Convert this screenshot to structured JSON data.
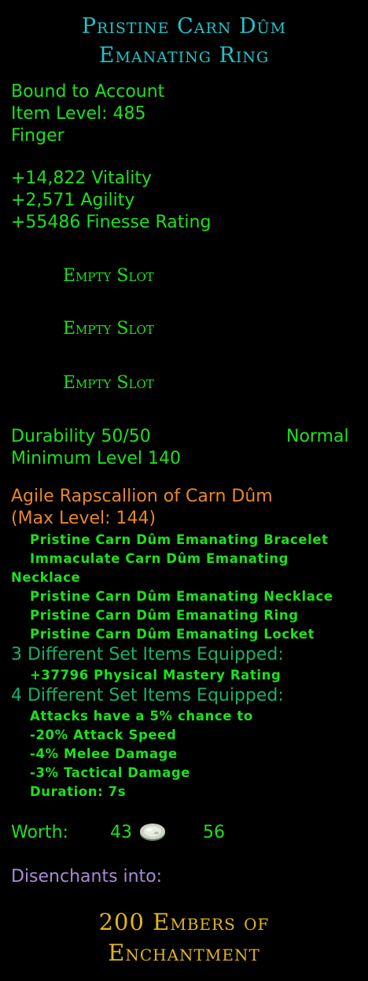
{
  "item": {
    "name_line1": "Pristine Carn Dûm",
    "name_line2": "Emanating Ring",
    "binding": "Bound to Account",
    "item_level": "Item Level: 485",
    "slot": "Finger",
    "stats": [
      "+14,822 Vitality",
      "+2,571 Agility",
      "+55486 Finesse Rating"
    ],
    "empty_slots": [
      "Empty Slot",
      "Empty Slot",
      "Empty Slot"
    ],
    "durability": "Durability 50/50",
    "durability_state": "Normal",
    "minimum_level": "Minimum Level 140"
  },
  "set": {
    "name": "Agile Rapscallion of Carn Dûm",
    "max_level": "(Max Level: 144)",
    "items": [
      "Pristine Carn Dûm Emanating Bracelet",
      "Immaculate Carn Dûm Emanating",
      "Necklace",
      "Pristine Carn Dûm Emanating Necklace",
      "Pristine Carn Dûm Emanating Ring",
      "Pristine Carn Dûm Emanating Locket"
    ],
    "bonus3_header": "3 Different Set Items Equipped:",
    "bonus3": [
      "+37796 Physical Mastery Rating"
    ],
    "bonus4_header": "4 Different Set Items Equipped:",
    "bonus4": [
      "Attacks have a 5% chance to",
      "-20% Attack Speed",
      "-4% Melee Damage",
      "-3% Tactical Damage",
      "Duration: 7s"
    ]
  },
  "worth": {
    "label": "Worth:",
    "gold": "43",
    "silver": "56",
    "coin_icon": "silver-coin-icon"
  },
  "disenchant": {
    "label": "Disenchants into:",
    "result_line1": "200 Embers of",
    "result_line2": "Enchantment"
  },
  "colors": {
    "title": "#22c3c8",
    "text": "#1ee01e",
    "set_name": "#e8872a",
    "set_header": "#19b06a",
    "disenchant_label": "#a98ad6",
    "disenchant_result": "#e0b51e",
    "background": "#000000"
  }
}
